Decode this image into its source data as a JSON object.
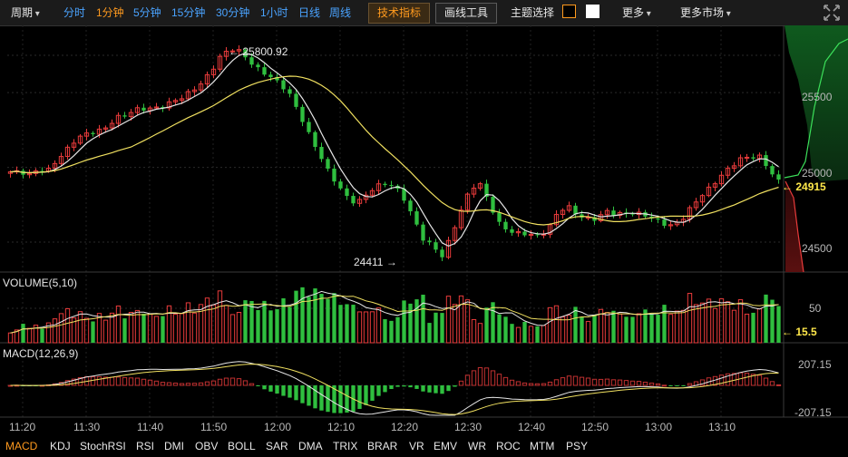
{
  "toolbar": {
    "period_menu": "周期",
    "periods": [
      "分时",
      "1分钟",
      "5分钟",
      "15分钟",
      "30分钟",
      "1小时",
      "日线",
      "周线"
    ],
    "active_period": "1分钟",
    "tech_indicator": "技术指标",
    "drawing_tools": "画线工具",
    "theme_select": "主题选择",
    "more": "更多",
    "more_markets": "更多市场",
    "fullscreen_icon": "expand-arrows-icon"
  },
  "price_panel": {
    "high_label": "25800.92",
    "low_label": "24411",
    "last_price": "24915",
    "y_ticks": [
      "25500",
      "25000",
      "24500"
    ]
  },
  "volume_panel": {
    "title": "VOLUME(5,10)",
    "y_tick": "50",
    "last_value": "15.5"
  },
  "macd_panel": {
    "title": "MACD(12,26,9)",
    "y_ticks": [
      "207.15",
      "-207.15"
    ]
  },
  "time_axis": [
    "11:20",
    "11:30",
    "11:40",
    "11:50",
    "12:00",
    "12:10",
    "12:20",
    "12:30",
    "12:40",
    "12:50",
    "13:00",
    "13:10"
  ],
  "indicator_tabs": [
    "MACD",
    "KDJ",
    "StochRSI",
    "RSI",
    "DMI",
    "OBV",
    "BOLL",
    "SAR",
    "DMA",
    "TRIX",
    "BRAR",
    "VR",
    "EMV",
    "WR",
    "ROC",
    "MTM",
    "PSY"
  ],
  "active_indicator": "MACD",
  "colors": {
    "up": "#e83b3b",
    "down": "#2fbf3f",
    "ma_fast": "#e6e6e6",
    "ma_slow": "#f0e060",
    "accent": "#ff9a1e",
    "link": "#4aa3ff",
    "last_price": "#ffe84a"
  },
  "chart_data": {
    "type": "candlestick",
    "price_range": [
      24300,
      25950
    ],
    "close_path": [
      24970,
      24975,
      24960,
      24990,
      24980,
      25050,
      25120,
      25200,
      25230,
      25250,
      25270,
      25330,
      25340,
      25380,
      25390,
      25400,
      25420,
      25450,
      25470,
      25510,
      25560,
      25650,
      25760,
      25800.92,
      25780,
      25700,
      25640,
      25600,
      25560,
      25500,
      25380,
      25240,
      25110,
      24980,
      24880,
      24800,
      24760,
      24820,
      24880,
      24890,
      24870,
      24780,
      24650,
      24520,
      24480,
      24411,
      24560,
      24720,
      24860,
      24880,
      24740,
      24620,
      24580,
      24560,
      24550,
      24530,
      24580,
      24700,
      24750,
      24690,
      24660,
      24650,
      24700,
      24680,
      24690,
      24700,
      24690,
      24660,
      24620,
      24600,
      24650,
      24740,
      24820,
      24880,
      24950,
      25000,
      25050,
      25060,
      25070,
      24990,
      24915
    ]
  }
}
